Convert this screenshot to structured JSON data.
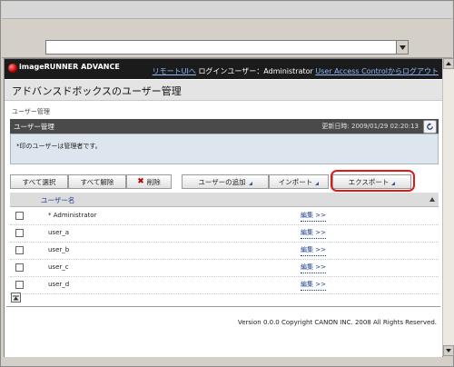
{
  "brand": {
    "name": "imageRUNNER ADVANCE"
  },
  "header_links": {
    "remote_ui": "リモートUIへ",
    "login_user_label": "ログインユーザー：",
    "login_user": "Administrator",
    "logout": "User Access Controlからログアウト"
  },
  "page": {
    "title": "アドバンスドボックスのユーザー管理",
    "breadcrumb": "ユーザー管理"
  },
  "section": {
    "title": "ユーザー管理",
    "updated_label": "更新日時",
    "updated_value": "2009/01/29 02:20:13",
    "note": "*印のユーザーは管理者です。"
  },
  "buttons": {
    "select_all": "すべて選択",
    "clear_all": "すべて解除",
    "delete": "削除",
    "add_user": "ユーザーの追加",
    "import": "インポート",
    "export": "エクスポート"
  },
  "table": {
    "header_name": "ユーザー名",
    "rows": [
      {
        "name": "* Administrator",
        "edit": "編集 >>"
      },
      {
        "name": "user_a",
        "edit": "編集 >>"
      },
      {
        "name": "user_b",
        "edit": "編集 >>"
      },
      {
        "name": "user_c",
        "edit": "編集 >>"
      },
      {
        "name": "user_d",
        "edit": "編集 >>"
      }
    ]
  },
  "footer": {
    "copyright": "Version 0.0.0 Copyright CANON INC. 2008 All Rights Reserved."
  },
  "colors": {
    "highlight_ring": "#e01818",
    "header_dark": "#1b1b1b",
    "link": "#1a3a8a"
  }
}
